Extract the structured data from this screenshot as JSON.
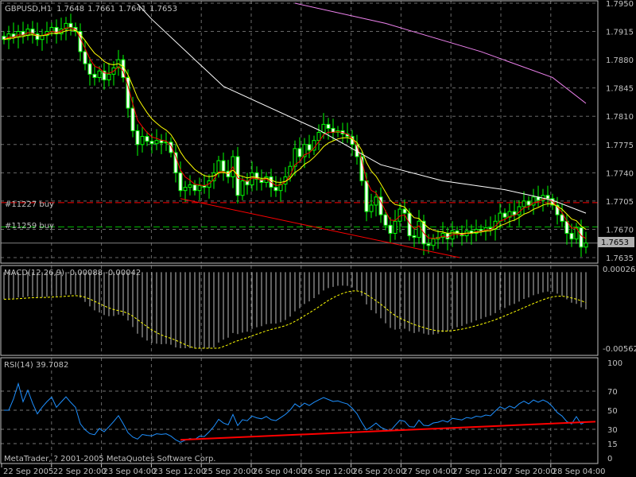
{
  "header": {
    "symbol": "GBPUSD,H1",
    "open": "1.7648",
    "high": "1.7661",
    "low": "1.7641",
    "close": "1.7653"
  },
  "copyright": "MetaTrader, ? 2001-2005 MetaQuotes Software Corp.",
  "orders": [
    {
      "label": "#11227 buy",
      "price": 1.7703,
      "color": "#ff0000"
    },
    {
      "label": "#11259 buy",
      "price": 1.7673,
      "color": "#00c000"
    }
  ],
  "current_price_label": "1.7653",
  "macd": {
    "label": "MACD(12,26,9) -0.00088 -0.00042",
    "max_label": "0.00026",
    "min_label": "-0.00562",
    "range": [
      -0.00562,
      0.00026
    ]
  },
  "rsi": {
    "label": "RSI(14) 39.7082",
    "levels": [
      "100",
      "70",
      "50",
      "30",
      "15",
      "0"
    ],
    "trend": [
      [
        37,
        19
      ],
      [
        124,
        38
      ]
    ]
  },
  "colors": {
    "bull": "#00ff00",
    "bear": "#ffffff",
    "fast_ma": "#ff0000",
    "slow_ma": "#ffff00",
    "ma_white": "#ffffff",
    "ma_violet": "#ee82ee",
    "rsi": "#1e90ff",
    "grid": "#c0c0c0"
  },
  "chart_data": {
    "type": "candlestick",
    "title": "GBPUSD,H1",
    "ylim": [
      1.7635,
      1.795
    ],
    "y_ticks": [
      "1.7950",
      "1.7915",
      "1.7880",
      "1.7845",
      "1.7810",
      "1.7775",
      "1.7740",
      "1.7705",
      "1.7670",
      "1.7635"
    ],
    "x_ticks": [
      "22 Sep 2005",
      "22 Sep 20:00",
      "23 Sep 04:00",
      "23 Sep 12:00",
      "25 Sep 20:00",
      "26 Sep 04:00",
      "26 Sep 12:00",
      "26 Sep 20:00",
      "27 Sep 04:00",
      "27 Sep 12:00",
      "27 Sep 20:00",
      "28 Sep 04:00"
    ],
    "closes": [
      1.7905,
      1.7912,
      1.7908,
      1.7915,
      1.791,
      1.7918,
      1.7912,
      1.7905,
      1.791,
      1.7915,
      1.792,
      1.7912,
      1.7918,
      1.7925,
      1.792,
      1.7915,
      1.789,
      1.7875,
      1.7862,
      1.7858,
      1.7866,
      1.7855,
      1.7862,
      1.787,
      1.788,
      1.7858,
      1.782,
      1.7792,
      1.7775,
      1.7785,
      1.7779,
      1.7776,
      1.778,
      1.7777,
      1.7778,
      1.7765,
      1.774,
      1.7718,
      1.7722,
      1.7725,
      1.7718,
      1.7724,
      1.7722,
      1.773,
      1.774,
      1.7755,
      1.7742,
      1.7735,
      1.776,
      1.7712,
      1.773,
      1.7725,
      1.774,
      1.7732,
      1.7728,
      1.7735,
      1.7722,
      1.7718,
      1.7726,
      1.7735,
      1.7748,
      1.777,
      1.776,
      1.7775,
      1.7768,
      1.778,
      1.779,
      1.78,
      1.7795,
      1.779,
      1.7792,
      1.7788,
      1.7785,
      1.7775,
      1.776,
      1.773,
      1.7692,
      1.77,
      1.771,
      1.7688,
      1.7675,
      1.7665,
      1.768,
      1.7695,
      1.769,
      1.7662,
      1.766,
      1.768,
      1.7652,
      1.765,
      1.7658,
      1.766,
      1.7665,
      1.7658,
      1.7668,
      1.7665,
      1.7662,
      1.7668,
      1.7665,
      1.767,
      1.7668,
      1.7672,
      1.767,
      1.768,
      1.769,
      1.7685,
      1.7692,
      1.7688,
      1.7698,
      1.7705,
      1.77,
      1.771,
      1.7706,
      1.7712,
      1.7708,
      1.77,
      1.7688,
      1.768,
      1.7665,
      1.7658,
      1.7672,
      1.7648,
      1.7653
    ],
    "ma_white": [
      [
        28,
        1.7949
      ],
      [
        31,
        1.793
      ],
      [
        46,
        1.7847
      ],
      [
        66,
        1.7793
      ],
      [
        79,
        1.775
      ],
      [
        92,
        1.773
      ],
      [
        105,
        1.7719
      ],
      [
        115,
        1.7706
      ],
      [
        122,
        1.769
      ]
    ],
    "ma_violet": [
      [
        61,
        1.795
      ],
      [
        80,
        1.7925
      ],
      [
        100,
        1.789
      ],
      [
        115,
        1.7858
      ],
      [
        122,
        1.7826
      ]
    ],
    "trendline": [
      [
        37,
        1.7708
      ],
      [
        95.5,
        1.7635
      ]
    ]
  }
}
